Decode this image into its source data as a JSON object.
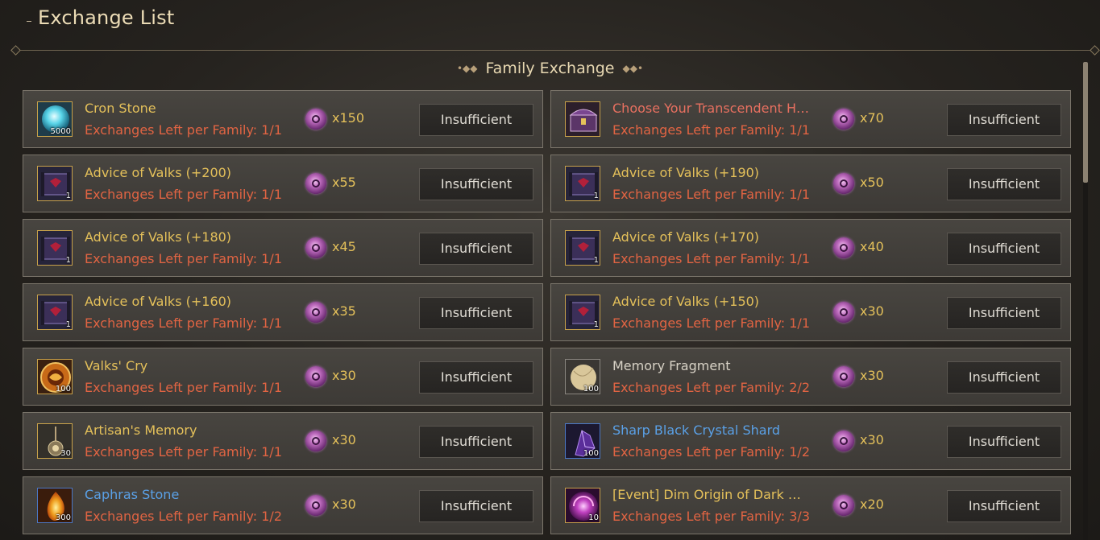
{
  "window": {
    "title": "Exchange List"
  },
  "section": {
    "title": "Family Exchange"
  },
  "colors": {
    "accent_gold": "#e4c05a",
    "limit_red": "#e16443",
    "rare_blue": "#5aa0e6"
  },
  "items": [
    {
      "name": "Cron Stone",
      "limit": "Exchanges Left per Family: 1/1",
      "qty": "5000",
      "cost": "x150",
      "button": "Insufficient",
      "icon": "cron-stone-icon",
      "grade": "gold"
    },
    {
      "name": "Choose Your Transcendent Ham...",
      "limit": "Exchanges Left per Family: 1/1",
      "qty": "",
      "cost": "x70",
      "button": "Insufficient",
      "icon": "chest-icon",
      "grade": "red"
    },
    {
      "name": "Advice of Valks (+200)",
      "limit": "Exchanges Left per Family: 1/1",
      "qty": "1",
      "cost": "x55",
      "button": "Insufficient",
      "icon": "scroll-icon",
      "grade": "gold"
    },
    {
      "name": "Advice of Valks (+190)",
      "limit": "Exchanges Left per Family: 1/1",
      "qty": "1",
      "cost": "x50",
      "button": "Insufficient",
      "icon": "scroll-icon",
      "grade": "gold"
    },
    {
      "name": "Advice of Valks (+180)",
      "limit": "Exchanges Left per Family: 1/1",
      "qty": "1",
      "cost": "x45",
      "button": "Insufficient",
      "icon": "scroll-icon",
      "grade": "gold"
    },
    {
      "name": "Advice of Valks (+170)",
      "limit": "Exchanges Left per Family: 1/1",
      "qty": "1",
      "cost": "x40",
      "button": "Insufficient",
      "icon": "scroll-icon",
      "grade": "gold"
    },
    {
      "name": "Advice of Valks (+160)",
      "limit": "Exchanges Left per Family: 1/1",
      "qty": "1",
      "cost": "x35",
      "button": "Insufficient",
      "icon": "scroll-icon",
      "grade": "gold"
    },
    {
      "name": "Advice of Valks (+150)",
      "limit": "Exchanges Left per Family: 1/1",
      "qty": "1",
      "cost": "x30",
      "button": "Insufficient",
      "icon": "scroll-icon",
      "grade": "gold"
    },
    {
      "name": "Valks' Cry",
      "limit": "Exchanges Left per Family: 1/1",
      "qty": "100",
      "cost": "x30",
      "button": "Insufficient",
      "icon": "valks-cry-icon",
      "grade": "gold"
    },
    {
      "name": "Memory Fragment",
      "limit": "Exchanges Left per Family: 2/2",
      "qty": "100",
      "cost": "x30",
      "button": "Insufficient",
      "icon": "memory-fragment-icon",
      "grade": "gray"
    },
    {
      "name": "Artisan's Memory",
      "limit": "Exchanges Left per Family: 1/1",
      "qty": "30",
      "cost": "x30",
      "button": "Insufficient",
      "icon": "artisan-memory-icon",
      "grade": "gold"
    },
    {
      "name": "Sharp Black Crystal Shard",
      "limit": "Exchanges Left per Family: 1/2",
      "qty": "100",
      "cost": "x30",
      "button": "Insufficient",
      "icon": "crystal-shard-icon",
      "grade": "blue"
    },
    {
      "name": "Caphras Stone",
      "limit": "Exchanges Left per Family: 1/2",
      "qty": "300",
      "cost": "x30",
      "button": "Insufficient",
      "icon": "caphras-stone-icon",
      "grade": "blue"
    },
    {
      "name": "[Event] Dim Origin of Dark Hun...",
      "limit": "Exchanges Left per Family: 3/3",
      "qty": "10",
      "cost": "x20",
      "button": "Insufficient",
      "icon": "dark-origin-icon",
      "grade": "gold"
    }
  ]
}
